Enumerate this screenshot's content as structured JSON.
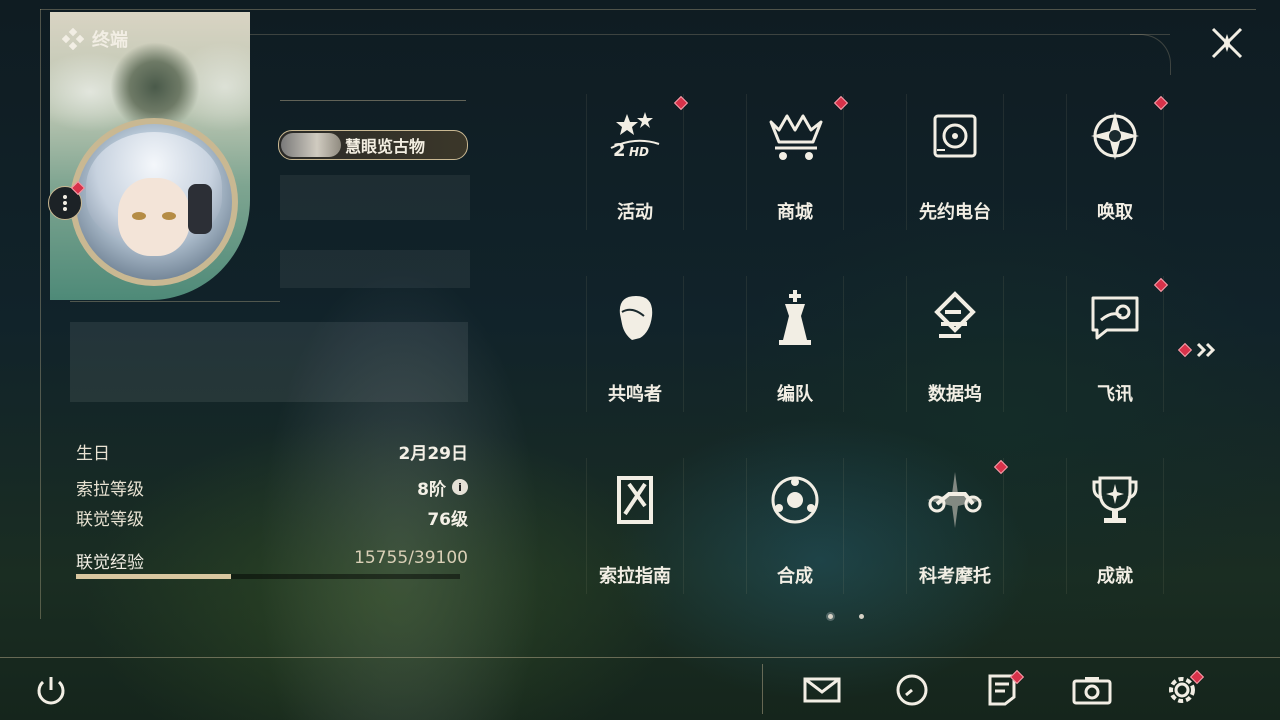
{
  "header": {
    "title": "终端"
  },
  "profile": {
    "title_badge": "慧眼览古物"
  },
  "stats": [
    {
      "label": "生日",
      "value": "2月29日"
    },
    {
      "label": "索拉等级",
      "value": "8阶"
    },
    {
      "label": "联觉等级",
      "value": "76级"
    }
  ],
  "experience": {
    "label": "联觉经验",
    "value": "15755/39100",
    "current": 15755,
    "max": 39100
  },
  "menu": [
    {
      "label": "活动",
      "icon": "event-icon",
      "has_alert": true
    },
    {
      "label": "商城",
      "icon": "shop-icon",
      "has_alert": true
    },
    {
      "label": "先约电台",
      "icon": "radio-icon",
      "has_alert": false
    },
    {
      "label": "唤取",
      "icon": "convene-icon",
      "has_alert": true
    },
    {
      "label": "共鸣者",
      "icon": "resonator-icon",
      "has_alert": false
    },
    {
      "label": "编队",
      "icon": "team-icon",
      "has_alert": false
    },
    {
      "label": "数据坞",
      "icon": "data-bank-icon",
      "has_alert": false
    },
    {
      "label": "飞讯",
      "icon": "messages-icon",
      "has_alert": true
    },
    {
      "label": "索拉指南",
      "icon": "guidebook-icon",
      "has_alert": false
    },
    {
      "label": "合成",
      "icon": "synthesis-icon",
      "has_alert": false
    },
    {
      "label": "科考摩托",
      "icon": "motorcycle-icon",
      "has_alert": true
    },
    {
      "label": "成就",
      "icon": "trophy-icon",
      "has_alert": false
    }
  ],
  "bottom_bar": [
    {
      "icon": "mail-icon",
      "has_alert": false
    },
    {
      "icon": "clock-icon",
      "has_alert": false
    },
    {
      "icon": "notice-icon",
      "has_alert": true
    },
    {
      "icon": "camera-icon",
      "has_alert": false
    },
    {
      "icon": "settings-icon",
      "has_alert": true
    }
  ],
  "colors": {
    "accent_gold": "#c9b892",
    "alert_red": "#d8324a",
    "text": "#f2eee4"
  }
}
